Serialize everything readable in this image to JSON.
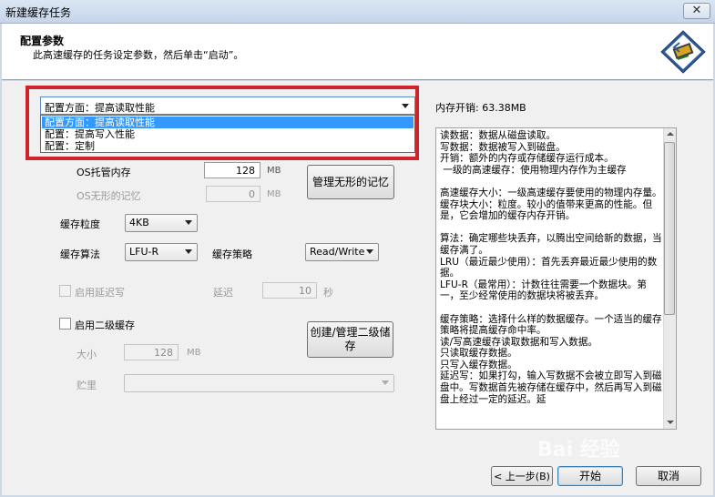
{
  "window": {
    "title": "新建缓存任务",
    "close_glyph": "✕"
  },
  "header": {
    "title": "配置参数",
    "subtitle": "此高速缓存的任务设定参数，然后单击“启动”。",
    "icon": "cache-chip-wizard-icon"
  },
  "config": {
    "selected": "配置方面：提高读取性能",
    "options": [
      "配置方面：提高读取性能",
      "配置：提高写入性能",
      "配置：定制"
    ],
    "highlight_color": "#d1232c"
  },
  "os_memory": {
    "label": "OS托管内存",
    "value": "128",
    "unit": "MB"
  },
  "os_invisible": {
    "label": "OS无形的记忆",
    "value": "0",
    "unit": "MB"
  },
  "manage_invisible_button": "管理无形的记忆",
  "cache_granularity": {
    "label": "缓存粒度",
    "value": "4KB"
  },
  "cache_algorithm": {
    "label": "缓存算法",
    "value": "LFU-R"
  },
  "cache_strategy": {
    "label": "缓存策略",
    "value": "Read/Write"
  },
  "delayed_write": {
    "label": "启用延迟写",
    "delay_label": "延迟",
    "delay_value": "10",
    "delay_unit": "秒"
  },
  "l2_cache": {
    "label": "启用二级缓存",
    "size_label": "大小",
    "size_value": "128",
    "size_unit": "MB",
    "storage_label": "贮里"
  },
  "create_l2_button": "创建/管理二级储存",
  "memory_cost": "内存开销: 63.38MB",
  "info_text": "读数据：数据从磁盘读取。\n写数据：数据被写入到磁盘。\n开销：额外的内存或存储缓存运行成本。\n 一级的高速缓存：使用物理内存作为主缓存\n\n高速缓存大小：一级高速缓存要使用的物理内存量。\n缓存块大小：粒度。较小的值带来更高的性能。但是，它会增加的缓存内存开销。\n\n算法：确定哪些块丢弃，以腾出空间给新的数据，当缓存满了。\nLRU（最近最少使用）：首先丢弃最近最少使用的数据。\nLFU-R（最常用）：计数往往需要一个数据块。第一，至少经常使用的数据块将被丢弃。\n\n缓存策略：选择什么样的数据缓存。一个适当的缓存策略将提高缓存命中率。\n读/写高速缓存读取数据和写入数据。\n只读取缓存数据。\n只写入缓存数据。\n延迟写：如果打勾，输入写数据不会被立即写入到磁盘中。写数据首先被存储在缓存中，然后再写入到磁盘上经过一定的延迟。延",
  "buttons": {
    "back": "< 上一步(B)",
    "start": "开始",
    "cancel": "取消"
  },
  "watermark": "Bai 经验"
}
